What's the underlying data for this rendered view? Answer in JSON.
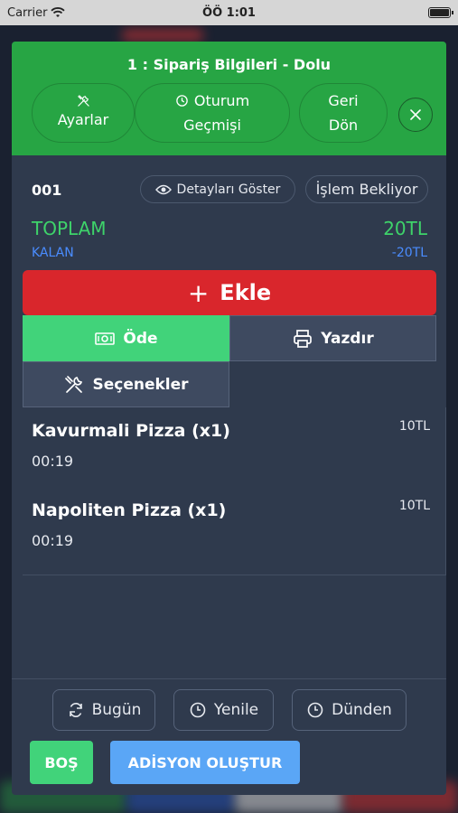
{
  "status_bar": {
    "carrier": "Carrier",
    "time": "ÖÖ 1:01"
  },
  "header": {
    "title": "1 : Sipariş Bilgileri - Dolu",
    "buttons": [
      {
        "label": "Ayarlar",
        "icon": "tools-icon"
      },
      {
        "label_line1": "Oturum",
        "label_line2": "Geçmişi",
        "icon": "history-icon"
      },
      {
        "label_line1": "Geri",
        "label_line2": "Dön"
      }
    ],
    "close_icon": "close-icon",
    "color": "#27a544"
  },
  "order": {
    "id": "001",
    "details_label": "Detayları Göster",
    "status_label": "İşlem Bekliyor",
    "total_label": "TOPLAM",
    "total_value": "20TL",
    "remaining_label": "KALAN",
    "remaining_value": "-20TL"
  },
  "actions": {
    "add_label": "Ekle",
    "pay_label": "Öde",
    "print_label": "Yazdır",
    "options_label": "Seçenekler"
  },
  "items": [
    {
      "name": "Kavurmali Pizza (x1)",
      "time": "00:19",
      "price": "10TL"
    },
    {
      "name": "Napoliten Pizza (x1)",
      "time": "00:19",
      "price": "10TL"
    }
  ],
  "footer": {
    "today_label": "Bugün",
    "refresh_label": "Yenile",
    "yesterday_label": "Dünden",
    "empty_label": "BOŞ",
    "create_bill_label": "ADİSYON OLUŞTUR"
  },
  "colors": {
    "green": "#3ed36a",
    "blue": "#4a8cff",
    "red": "#d9262c",
    "light_blue": "#5aa6f6"
  }
}
